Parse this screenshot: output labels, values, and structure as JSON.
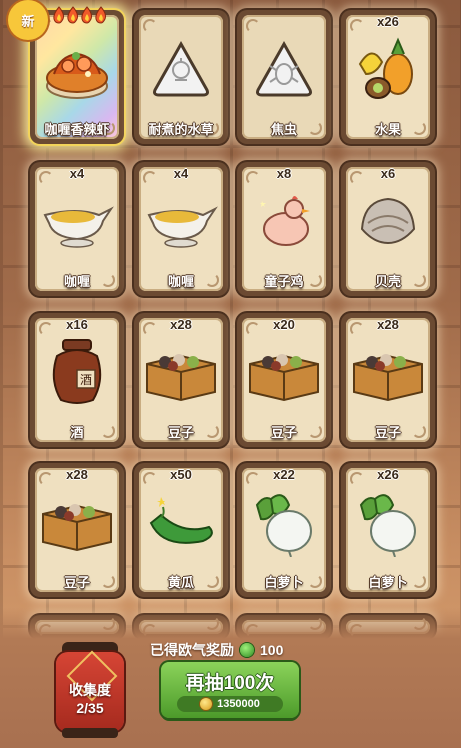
{
  "new_badge": "新",
  "cards": [
    {
      "count": "",
      "label": "咖喱香辣虾",
      "icon": "curry-shrimp-icon",
      "special": true
    },
    {
      "count": "",
      "label": "耐煮的水草",
      "icon": "unknown-seaweed-icon",
      "unknown": true
    },
    {
      "count": "",
      "label": "焦虫",
      "icon": "unknown-bug-icon",
      "unknown": true
    },
    {
      "count": "x26",
      "label": "水果",
      "icon": "fruit-icon"
    },
    {
      "count": "x4",
      "label": "咖喱",
      "icon": "curry-sauce-icon"
    },
    {
      "count": "x4",
      "label": "咖喱",
      "icon": "curry-sauce-icon"
    },
    {
      "count": "x8",
      "label": "童子鸡",
      "icon": "chicken-icon"
    },
    {
      "count": "x6",
      "label": "贝壳",
      "icon": "shell-icon"
    },
    {
      "count": "x16",
      "label": "酒",
      "icon": "wine-jar-icon"
    },
    {
      "count": "x28",
      "label": "豆子",
      "icon": "beans-box-icon"
    },
    {
      "count": "x20",
      "label": "豆子",
      "icon": "beans-box-icon"
    },
    {
      "count": "x28",
      "label": "豆子",
      "icon": "beans-box-icon"
    },
    {
      "count": "x28",
      "label": "豆子",
      "icon": "beans-box-icon"
    },
    {
      "count": "x50",
      "label": "黄瓜",
      "icon": "cucumber-icon"
    },
    {
      "count": "x22",
      "label": "白萝卜",
      "icon": "radish-icon"
    },
    {
      "count": "x26",
      "label": "白萝卜",
      "icon": "radish-icon"
    }
  ],
  "collection": {
    "title": "收集度",
    "progress": "2/35"
  },
  "reward": {
    "text": "已得欧气奖励",
    "amount": "100"
  },
  "draw": {
    "label": "再抽100次",
    "cost": "1350000"
  },
  "jar_char": "酒"
}
